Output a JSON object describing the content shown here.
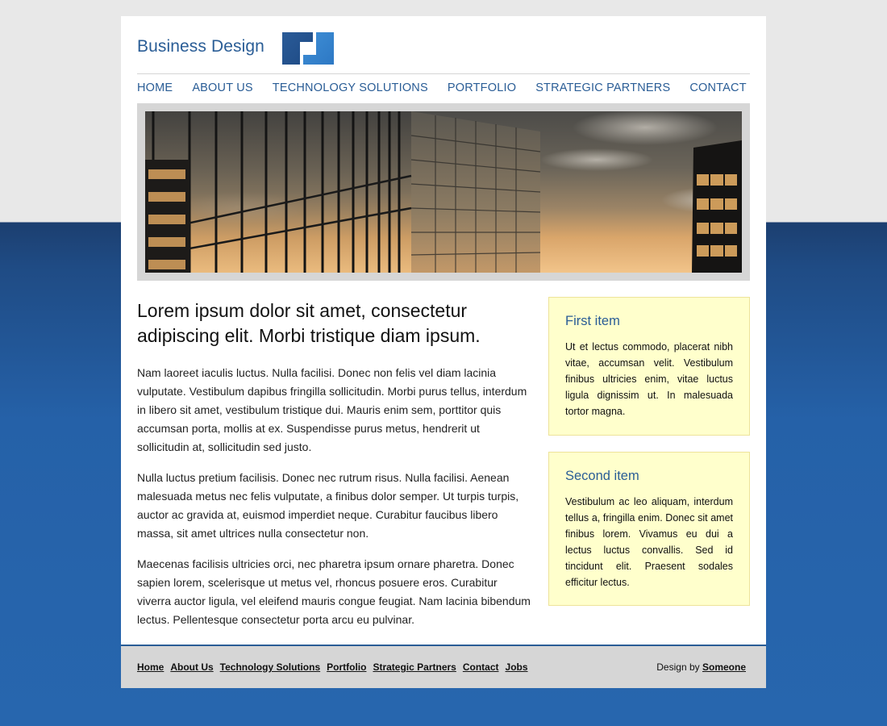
{
  "site": {
    "title": "Business Design"
  },
  "nav": {
    "items": [
      {
        "label": "HOME"
      },
      {
        "label": "ABOUT US"
      },
      {
        "label": "TECHNOLOGY SOLUTIONS"
      },
      {
        "label": "PORTFOLIO"
      },
      {
        "label": "STRATEGIC PARTNERS"
      },
      {
        "label": "CONTACT"
      }
    ]
  },
  "main": {
    "headline": "Lorem ipsum dolor sit amet, consectetur adipiscing elit. Morbi tristique diam ipsum.",
    "paragraphs": [
      "Nam laoreet iaculis luctus. Nulla facilisi. Donec non felis vel diam lacinia vulputate. Vestibulum dapibus fringilla sollicitudin. Morbi purus tellus, interdum in libero sit amet, vestibulum tristique dui. Mauris enim sem, porttitor quis accumsan porta, mollis at ex. Suspendisse purus metus, hendrerit ut sollicitudin at, sollicitudin sed justo.",
      "Nulla luctus pretium facilisis. Donec nec rutrum risus. Nulla facilisi. Aenean malesuada metus nec felis vulputate, a finibus dolor semper. Ut turpis turpis, auctor ac gravida at, euismod imperdiet neque. Curabitur faucibus libero massa, sit amet ultrices nulla consectetur non.",
      "Maecenas facilisis ultricies orci, nec pharetra ipsum ornare pharetra. Donec sapien lorem, scelerisque ut metus vel, rhoncus posuere eros. Curabitur viverra auctor ligula, vel eleifend mauris congue feugiat. Nam lacinia bibendum lectus. Pellentesque consectetur porta arcu eu pulvinar."
    ]
  },
  "sidebar": {
    "items": [
      {
        "title": "First item",
        "text": "Ut et lectus commodo, placerat nibh vitae, accumsan velit. Vestibulum finibus ultricies enim, vitae luctus ligula dignissim ut. In malesuada tortor magna."
      },
      {
        "title": "Second item",
        "text": "Vestibulum ac leo aliquam, interdum tellus a, fringilla enim. Donec sit amet finibus lorem. Vivamus eu dui a lectus luctus convallis. Sed id tincidunt elit. Praesent sodales efficitur lectus."
      }
    ]
  },
  "footer": {
    "links": [
      {
        "label": "Home"
      },
      {
        "label": "About Us"
      },
      {
        "label": "Technology Solutions"
      },
      {
        "label": "Portfolio"
      },
      {
        "label": "Strategic Partners"
      },
      {
        "label": "Contact"
      },
      {
        "label": "Jobs"
      }
    ],
    "credit_prefix": "Design by",
    "credit_name": "Someone"
  },
  "colors": {
    "brand": "#2a5d96",
    "background_top": "#e8e8e8",
    "background_bottom": "#2766ae",
    "sidebar_box": "#ffffcc",
    "footer": "#d6d6d6"
  },
  "icons": {
    "logo": "logo-icon"
  }
}
